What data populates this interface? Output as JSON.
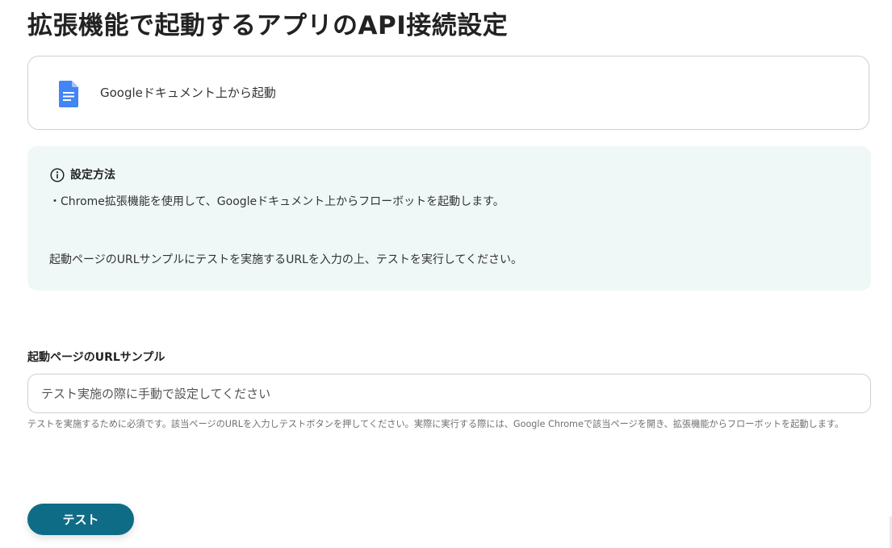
{
  "header": {
    "title": "拡張機能で起動するアプリのAPI接続設定"
  },
  "app_card": {
    "icon": "google-docs-icon",
    "label": "Googleドキュメント上から起動"
  },
  "info_box": {
    "icon": "info-circle-icon",
    "heading": "設定方法",
    "line1": "・Chrome拡張機能を使用して、Googleドキュメント上からフローボットを起動します。",
    "line2": "起動ページのURLサンプルにテストを実施するURLを入力の上、テストを実行してください。"
  },
  "url_field": {
    "label": "起動ページのURLサンプル",
    "value": "",
    "placeholder": "テスト実施の際に手動で設定してください",
    "help": "テストを実施するために必須です。該当ページのURLを入力しテストボタンを押してください。実際に実行する際には、Google Chromeで該当ページを開き、拡張機能からフローボットを起動します。"
  },
  "actions": {
    "test_label": "テスト"
  },
  "colors": {
    "primary_button": "#0f6c86",
    "info_background": "#eff8f7",
    "docs_blue": "#4285f4",
    "border": "#cfcfcf"
  }
}
